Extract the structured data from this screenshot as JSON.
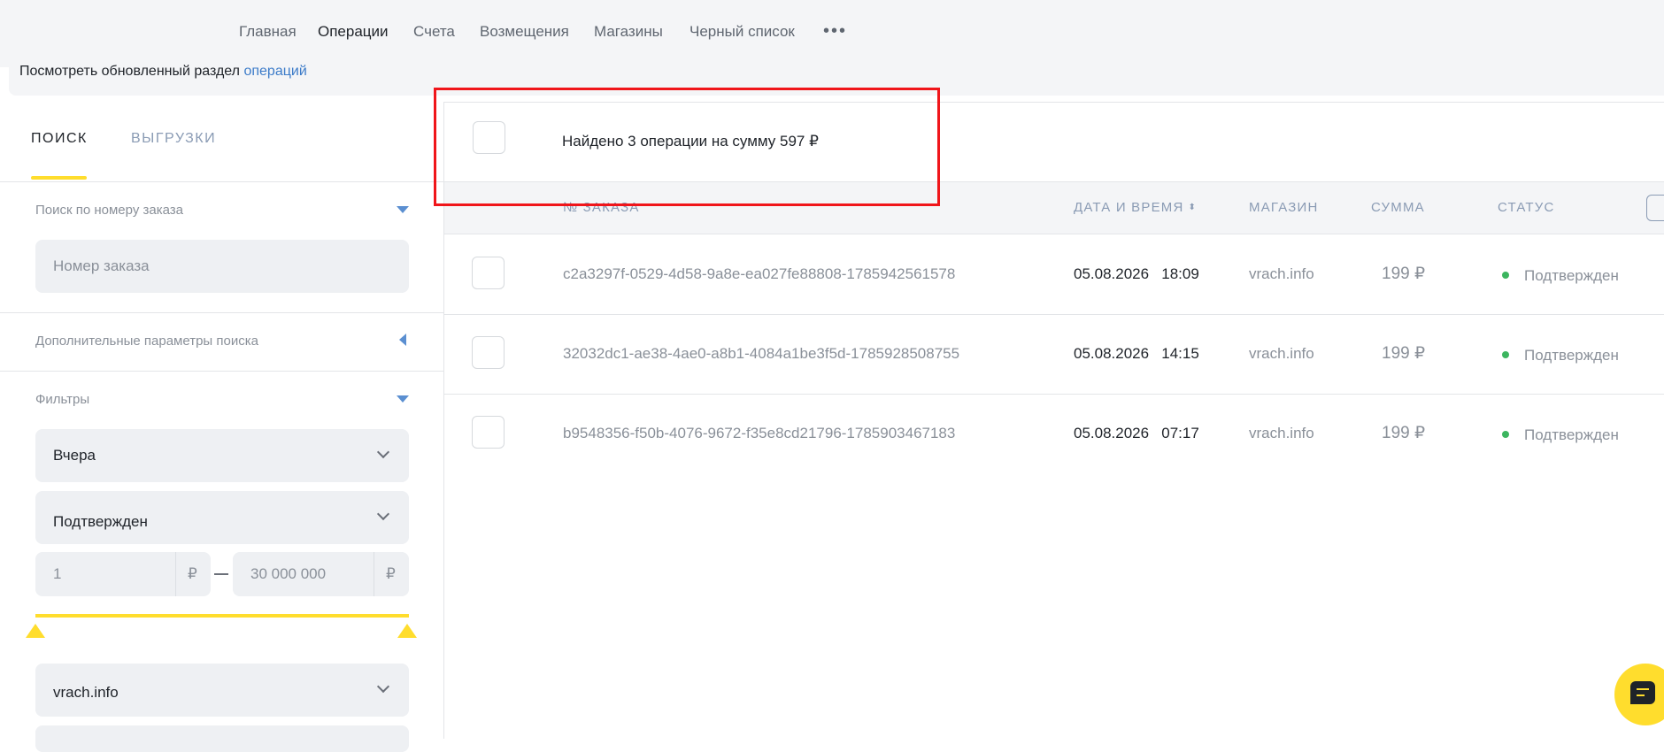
{
  "nav": {
    "items": [
      "Главная",
      "Операции",
      "Счета",
      "Возмещения",
      "Магазины",
      "Черный список"
    ],
    "more": "•••"
  },
  "notice": {
    "text": "Посмотреть обновленный раздел ",
    "link": "операций"
  },
  "sidebar": {
    "tabs": [
      "ПОИСК",
      "ВЫГРУЗКИ"
    ],
    "order_search": {
      "title": "Поиск по номеру заказа",
      "placeholder": "Номер заказа"
    },
    "extra_params": {
      "title": "Дополнительные параметры поиска"
    },
    "filters": {
      "title": "Фильтры",
      "period": "Вчера",
      "status": "Подтвержден",
      "amount_from": "1",
      "amount_to": "30 000 000",
      "currency": "₽",
      "shop": "vrach.info"
    }
  },
  "summary": {
    "text": "Найдено 3 операции на сумму 597 ₽"
  },
  "table": {
    "headers": [
      "№ ЗАКАЗА",
      "ДАТА И ВРЕМЯ",
      "МАГАЗИН",
      "СУММА",
      "СТАТУС"
    ],
    "sort_icon": "⬍",
    "rows": [
      {
        "order": "c2a3297f-0529-4d58-9a8e-ea027fe88808-1785942561578",
        "date": "05.08.2026",
        "time": "18:09",
        "shop": "vrach.info",
        "sum": "199 ₽",
        "status": "Подтвержден"
      },
      {
        "order": "32032dc1-ae38-4ae0-a8b1-4084a1be3f5d-1785928508755",
        "date": "05.08.2026",
        "time": "14:15",
        "shop": "vrach.info",
        "sum": "199 ₽",
        "status": "Подтвержден"
      },
      {
        "order": "b9548356-f50b-4076-9672-f35e8cd21796-1785903467183",
        "date": "05.08.2026",
        "time": "07:17",
        "shop": "vrach.info",
        "sum": "199 ₽",
        "status": "Подтвержден"
      }
    ]
  },
  "colors": {
    "accent_yellow": "#ffdd2d",
    "link_blue": "#3d7cc9",
    "status_green": "#3cb55f",
    "highlight_red": "#f0151a"
  }
}
